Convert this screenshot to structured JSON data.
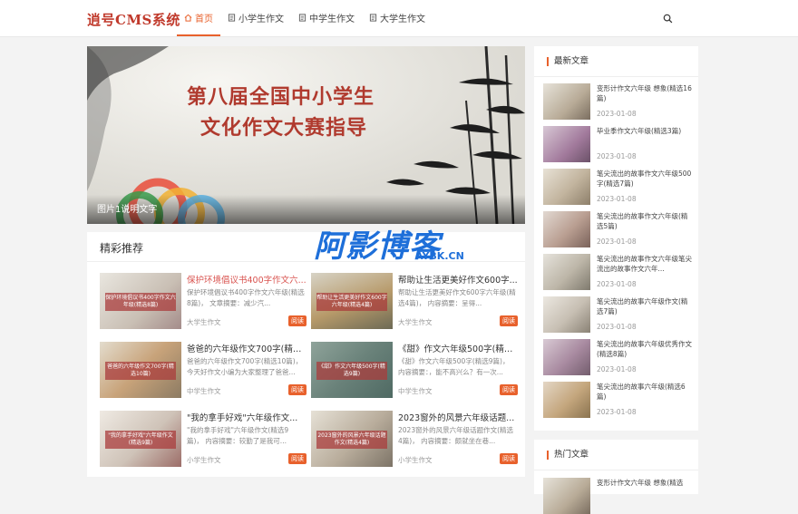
{
  "header": {
    "logo": "逍号CMS系统",
    "nav": [
      {
        "label": "首页",
        "active": true,
        "icon": "home-icon"
      },
      {
        "label": "小学生作文",
        "active": false,
        "icon": "document-icon"
      },
      {
        "label": "中学生作文",
        "active": false,
        "icon": "document-icon"
      },
      {
        "label": "大学生作文",
        "active": false,
        "icon": "document-icon"
      }
    ],
    "search_icon": "search-icon"
  },
  "banner": {
    "title_line1": "第八届全国中小学生",
    "title_line2": "文化作文大赛指导",
    "caption": "图片1说明文字"
  },
  "featured": {
    "title": "精彩推荐",
    "cards": [
      {
        "title": "保护环境倡议书400字作文六...",
        "desc": "保护环境倡议书400字作文六年级(精选8篇)，   文章摘要：减少汽...",
        "category": "大学生作文",
        "read": "阅读",
        "thumb_text": "保护环境倡议书400字作文六年级(精选8篇)"
      },
      {
        "title": "帮助让生活更美好作文600字...",
        "desc": "帮助让生活更美好作文600字六年级(精选4篇)，   内容摘要：呈得...",
        "category": "大学生作文",
        "read": "阅读",
        "thumb_text": "帮助让生活更美好作文600字六年级(精选4篇)"
      },
      {
        "title": "爸爸的六年级作文700字(精选...",
        "desc": "爸爸的六年级作文700字(精选10篇)，今天好作文小编为大家整理了爸爸...",
        "category": "中学生作文",
        "read": "阅读",
        "thumb_text": "爸爸的六年级作文700字(精选10篇)"
      },
      {
        "title": "《甜》作文六年级500字(精选...",
        "desc": "《甜》作文六年级500字(精选9篇)，  内容摘要：，能不高兴么？有一次...",
        "category": "中学生作文",
        "read": "阅读",
        "thumb_text": "《甜》作文六年级500字(精选9篇)"
      },
      {
        "title": "\"我的拿手好戏\"六年级作文...",
        "desc": "\"我的拿手好戏\"六年级作文(精选9篇)，   内容摘要：较勤了是我可...",
        "category": "小学生作文",
        "read": "阅读",
        "thumb_text": "\"我的拿手好戏\"六年级作文(精选9篇)"
      },
      {
        "title": "2023窗外的风景六年级话题...",
        "desc": "2023窗外的风景六年级话题作文(精选4篇)，   内容摘要：颇就坐在巷...",
        "category": "小学生作文",
        "read": "阅读",
        "thumb_text": "2023窗外的风景六年级话题作文(精选4篇)"
      }
    ]
  },
  "latest": {
    "title": "最新文章",
    "items": [
      {
        "title": "变形计作文六年级 想象(精选16篇)",
        "date": "2023-01-08"
      },
      {
        "title": "毕业季作文六年级(精选3篇)",
        "date": "2023-01-08"
      },
      {
        "title": "笔尖流出的故事作文六年级500字(精选7篇)",
        "date": "2023-01-08"
      },
      {
        "title": "笔尖流出的故事作文六年级(精选5篇)",
        "date": "2023-01-08"
      },
      {
        "title": "笔尖流出的故事作文六年级笔尖流出的故事作文六年...",
        "date": "2023-01-08"
      },
      {
        "title": "笔尖流出的故事六年级作文(精选7篇)",
        "date": "2023-01-08"
      },
      {
        "title": "笔尖流出的故事六年级优秀作文(精选8篇)",
        "date": "2023-01-08"
      },
      {
        "title": "笔尖流出的故事六年级(精选6篇)",
        "date": "2023-01-08"
      }
    ]
  },
  "hot": {
    "title": "热门文章",
    "items": [
      {
        "title": "变形计作文六年级 想象(精选",
        "date": ""
      }
    ]
  },
  "watermark": {
    "text": "阿影博客",
    "sub": "AYBK.CN"
  },
  "colors": {
    "accent": "#e8612c",
    "logo": "#c0392b",
    "banner_text": "#b03a2e"
  }
}
